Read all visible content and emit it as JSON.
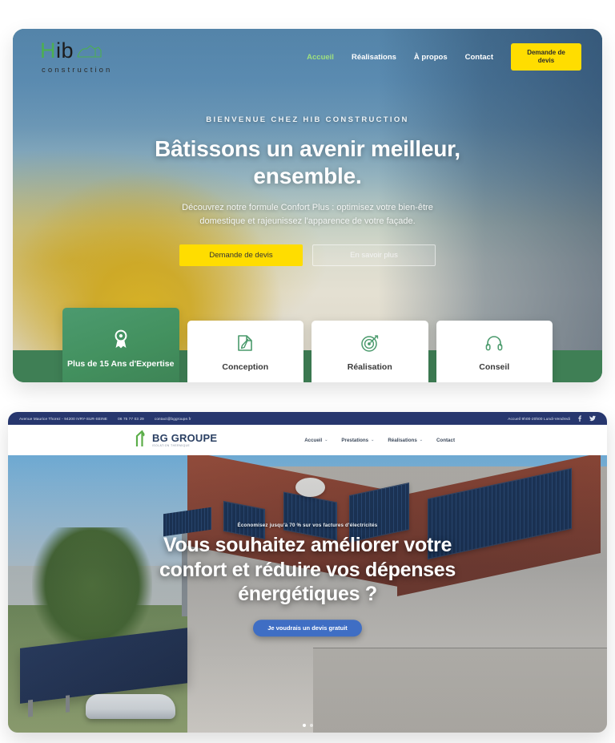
{
  "site1": {
    "logo": {
      "name_green": "H",
      "name_dark": "ib",
      "subtitle": "construction",
      "icon": "house-outline-icon"
    },
    "nav": [
      {
        "label": "Accueil",
        "active": true
      },
      {
        "label": "Réalisations",
        "active": false
      },
      {
        "label": "À propos",
        "active": false
      },
      {
        "label": "Contact",
        "active": false
      }
    ],
    "nav_cta": "Demande de devis",
    "hero": {
      "eyebrow": "BIENVENUE CHEZ HIB CONSTRUCTION",
      "title_line1": "Bâtissons un avenir meilleur,",
      "title_line2": "ensemble.",
      "subtitle_line1": "Découvrez notre formule Confort Plus : optimisez votre bien-être",
      "subtitle_line2": "domestique et rajeunissez l'apparence de votre façade.",
      "cta_primary": "Demande de devis",
      "cta_secondary": "En savoir plus"
    },
    "feature_cards": [
      {
        "label": "Plus de 15 Ans d'Expertise",
        "icon": "award-ribbon-icon",
        "primary": true
      },
      {
        "label": "Conception",
        "icon": "pencil-draft-icon",
        "primary": false
      },
      {
        "label": "Réalisation",
        "icon": "target-arrow-icon",
        "primary": false
      },
      {
        "label": "Conseil",
        "icon": "headset-icon",
        "primary": false
      }
    ],
    "colors": {
      "accent_yellow": "#ffdd00",
      "brand_green": "#4caf50",
      "card_green": "#43915f"
    }
  },
  "site2": {
    "utilbar": {
      "address": "Avenue Maurice Thorez - 94200 IVRY-SUR-SEINE",
      "phone": "06 75 77 03 29",
      "email": "contact@bggroupe.fr",
      "hours": "Accueil 9h00-20h00 Lundi-Vendredi",
      "social": [
        {
          "name": "facebook-icon"
        },
        {
          "name": "twitter-icon"
        }
      ]
    },
    "logo": {
      "name": "BG GROUPE",
      "tagline": "ISOLATION THERMIQUE",
      "icon": "green-house-leaf-icon"
    },
    "nav": [
      {
        "label": "Accueil",
        "caret": true
      },
      {
        "label": "Prestations",
        "caret": true
      },
      {
        "label": "Réalisations",
        "caret": true
      },
      {
        "label": "Contact",
        "caret": false
      }
    ],
    "hero": {
      "eyebrow": "Économisez jusqu'à 70 % sur vos factures d'électricités",
      "title_line1": "Vous souhaitez améliorer votre",
      "title_line2": "confort et réduire vos dépenses",
      "title_line3": "énergétiques ?",
      "cta": "Je voudrais un devis gratuit"
    },
    "carousel_dots": [
      {
        "active": true
      },
      {
        "active": false
      }
    ],
    "colors": {
      "navy": "#27376e",
      "cta_blue": "#3f6ec4"
    }
  }
}
